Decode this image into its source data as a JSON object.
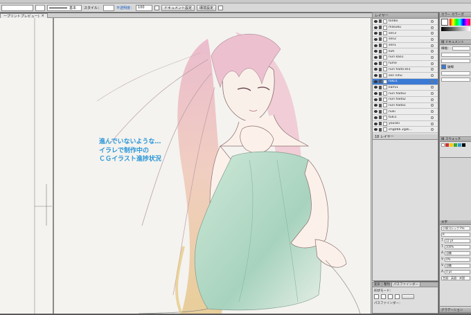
{
  "controlbar": {
    "stroke_weight": "基本",
    "style_label": "スタイル：",
    "opacity_label": "不透明度：",
    "opacity_value": "100",
    "doc_settings_button": "ドキュメント設定",
    "env_settings_button": "環境設定"
  },
  "document": {
    "tab_label": "ープリントプレビュー)"
  },
  "layers": {
    "title": "レイヤー",
    "items": [
      {
        "name": "tonbo",
        "selected": false
      },
      {
        "name": "masuku",
        "selected": false
      },
      {
        "name": "sen3",
        "selected": false
      },
      {
        "name": "sen2",
        "selected": false
      },
      {
        "name": "sen1",
        "selected": false
      },
      {
        "name": "kuti",
        "selected": false
      },
      {
        "name": "nuri kao1",
        "selected": false
      },
      {
        "name": "fume",
        "selected": false
      },
      {
        "name": "nuri hada ke1",
        "selected": false
      },
      {
        "name": "sen nihu",
        "selected": false
      },
      {
        "name": "fuku1",
        "selected": true
      },
      {
        "name": "kami1",
        "selected": false
      },
      {
        "name": "nuri hada3",
        "selected": false
      },
      {
        "name": "nuri hada2",
        "selected": false
      },
      {
        "name": "nuri hada1",
        "selected": false
      },
      {
        "name": "nuki",
        "selected": false
      },
      {
        "name": "tuki1",
        "selected": false
      },
      {
        "name": "yousiki",
        "selected": false
      },
      {
        "name": "img066 2gsk...",
        "selected": false
      }
    ],
    "footer": "18 レイヤー"
  },
  "pathfinder": {
    "tabs": [
      "変形",
      "整列",
      "パスファインダー"
    ],
    "shape_mode_label": "形状モード：",
    "pathfinder_label": "パスファインダー："
  },
  "right_panels": {
    "color_tab": "カラー",
    "color_tab2": "カラーガ",
    "stroke_panel": "線",
    "doc_tab": "ドキュメント",
    "weight_label": "線幅：",
    "dashed_label": "破線",
    "swatch_tab1": "線",
    "swatch_tab2": "スウォッチ",
    "char_panel": "文字",
    "font_family": "小塚ゴシック Pro",
    "font_style": "R",
    "font_size": "12 pt",
    "leading": "自動",
    "vertical_scale": "100%",
    "tracking": "0%",
    "kerning": "自動",
    "baseline": "0 pt",
    "language": "言語：英語：米国",
    "gradient_tab": "グラデーション"
  },
  "overlay_text": {
    "line1": "進んでいないような…",
    "line2": "イラレで制作中の",
    "line3": "ＣＧイラスト進捗状況"
  },
  "colors": {
    "selection": "#3a7ad5",
    "overlay_text": "#2a96d8"
  }
}
